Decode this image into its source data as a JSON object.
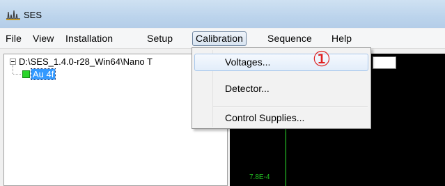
{
  "window": {
    "title": "SES"
  },
  "menubar": {
    "items": [
      {
        "label": "File"
      },
      {
        "label": "View"
      },
      {
        "label": "Installation"
      },
      {
        "label": "Setup"
      },
      {
        "label": "Calibration"
      },
      {
        "label": "Sequence"
      },
      {
        "label": "Help"
      }
    ]
  },
  "tree": {
    "root_label": "D:\\SES_1.4.0-r28_Win64\\Nano T",
    "child_label": "Au 4f"
  },
  "calibration_menu": {
    "items": [
      {
        "label": "Voltages..."
      },
      {
        "label": "Detector..."
      },
      {
        "label": "Control Supplies..."
      }
    ]
  },
  "annotation": {
    "text": "①",
    "color": "#e02020"
  },
  "plot": {
    "partial_label": "7.8E-4"
  },
  "colors": {
    "titlebar": "#bcd4ec",
    "selection": "#3399ff",
    "tree_marker": "#2bd62b",
    "plot_background": "#000000",
    "plot_line": "#2ee82e"
  }
}
